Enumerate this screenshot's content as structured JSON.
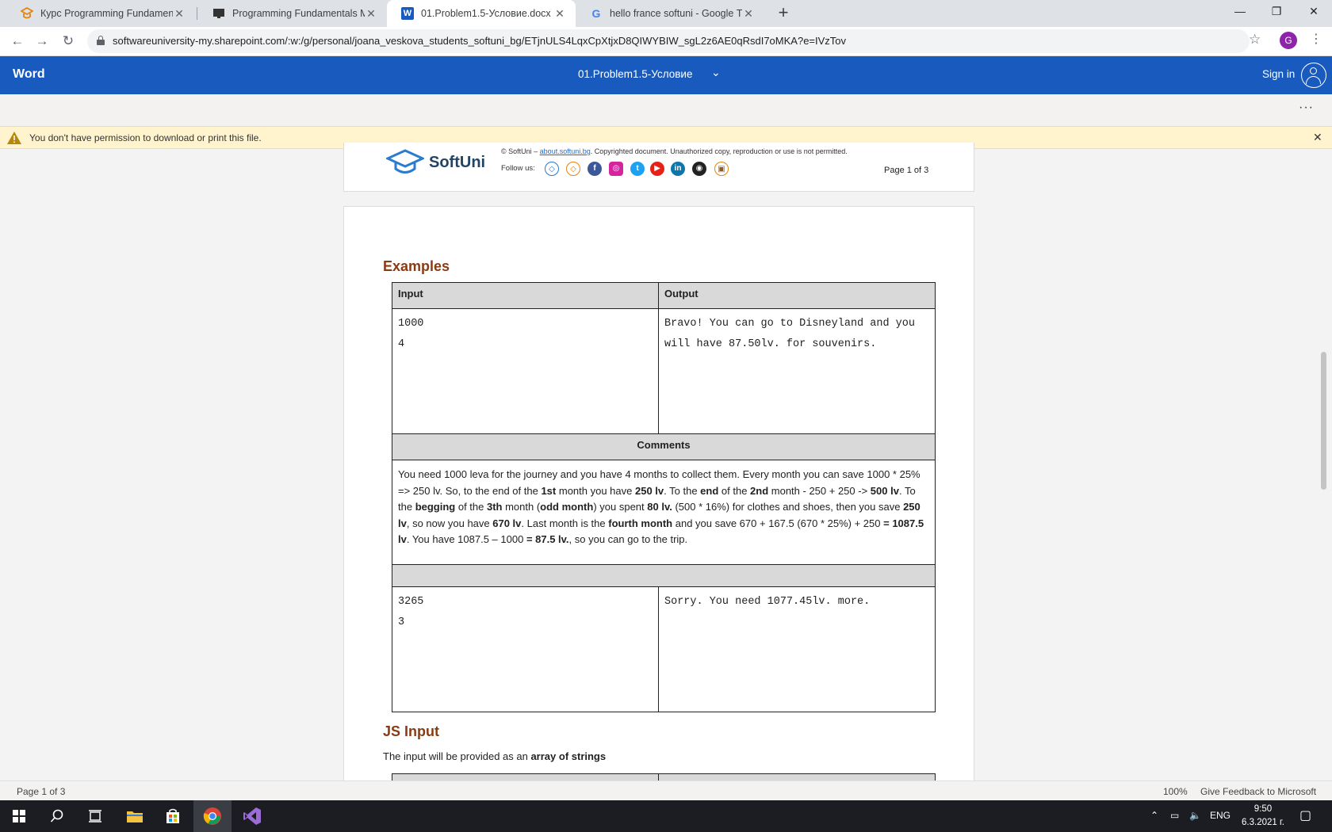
{
  "browser": {
    "tabs": [
      {
        "title": "Курс Programming Fundamentals",
        "icon": "softuni-icon",
        "active": false
      },
      {
        "title": "Programming Fundamentals Mid",
        "icon": "monitor-icon",
        "active": false
      },
      {
        "title": "01.Problem1.5-Условие.docx",
        "icon": "word-icon",
        "active": true
      },
      {
        "title": "hello france softuni - Google Тър",
        "icon": "google-icon",
        "active": false
      }
    ],
    "url": "softwareuniversity-my.sharepoint.com/:w:/g/personal/joana_veskova_students_softuni_bg/ETjnULS4LqxCpXtjxD8QIWYBIW_sgL2z6AE0qRsdI7oMKA?e=IVzTov",
    "profile_initial": "G"
  },
  "word": {
    "app_name": "Word",
    "doc_title": "01.Problem1.5-Условие",
    "sign_in": "Sign in",
    "more": "···",
    "notice": "You don't have permission to download or print this file."
  },
  "footer": {
    "logo_text": "SoftUni",
    "copyright_prefix": "© SoftUni –",
    "copyright_link": "about.softuni.bg",
    "copyright_suffix": ". Copyrighted document. Unauthorized copy, reproduction or use is not permitted.",
    "follow_us": "Follow us:",
    "page_label": "Page 1 of 3"
  },
  "doc": {
    "examples_heading": "Examples",
    "table": {
      "col_input": "Input",
      "col_output": "Output",
      "ex1_input": [
        "1000",
        "4"
      ],
      "ex1_output": [
        "Bravo! You can go to Disneyland and you",
        "will have 87.50lv. for souvenirs."
      ],
      "comments_heading": "Comments",
      "comments_parts": [
        {
          "t": "You need 1000 leva for the journey and you have 4 months to collect them. Every month you can save 1000 * 25% => 250 lv. So, to the end of the ",
          "b": false
        },
        {
          "t": "1st",
          "b": true
        },
        {
          "t": " month you have ",
          "b": false
        },
        {
          "t": "250 lv",
          "b": true
        },
        {
          "t": ". To the ",
          "b": false
        },
        {
          "t": "end",
          "b": true
        },
        {
          "t": " of the ",
          "b": false
        },
        {
          "t": "2nd",
          "b": true
        },
        {
          "t": " month -  250 + 250 -> ",
          "b": false
        },
        {
          "t": "500 lv",
          "b": true
        },
        {
          "t": ". To the ",
          "b": false
        },
        {
          "t": "begging",
          "b": true
        },
        {
          "t": " of the ",
          "b": false
        },
        {
          "t": "3th",
          "b": true
        },
        {
          "t": " month (",
          "b": false
        },
        {
          "t": "odd month",
          "b": true
        },
        {
          "t": ") you spent ",
          "b": false
        },
        {
          "t": "80 lv.",
          "b": true
        },
        {
          "t": " (500 * 16%) for clothes and shoes, then you save ",
          "b": false
        },
        {
          "t": "250 lv",
          "b": true
        },
        {
          "t": ", so now you have ",
          "b": false
        },
        {
          "t": "670 lv",
          "b": true
        },
        {
          "t": ". Last month is the ",
          "b": false
        },
        {
          "t": "fourth month",
          "b": true
        },
        {
          "t": " and you save 670 + 167.5 (670 * 25%) + 250 ",
          "b": false
        },
        {
          "t": "= 1087.5 lv",
          "b": true
        },
        {
          "t": ". You have 1087.5 – 1000 ",
          "b": false
        },
        {
          "t": "= 87.5 lv.",
          "b": true
        },
        {
          "t": ", so you can go to the trip.",
          "b": false
        }
      ],
      "ex2_input": [
        "3265",
        "3"
      ],
      "ex2_output": [
        "Sorry. You need 1077.45lv. more."
      ]
    },
    "js_heading": "JS Input",
    "js_text_prefix": "The input will be provided as an ",
    "js_text_bold": "array of strings"
  },
  "status": {
    "page": "Page 1 of 3",
    "zoom": "100%",
    "feedback": "Give Feedback to Microsoft"
  },
  "taskbar": {
    "lang": "ENG",
    "time": "9:50",
    "date": "6.3.2021 г."
  },
  "colors": {
    "word_blue": "#185abd",
    "heading_brown": "#8a3b12",
    "notice_yellow": "#fff4ce"
  }
}
